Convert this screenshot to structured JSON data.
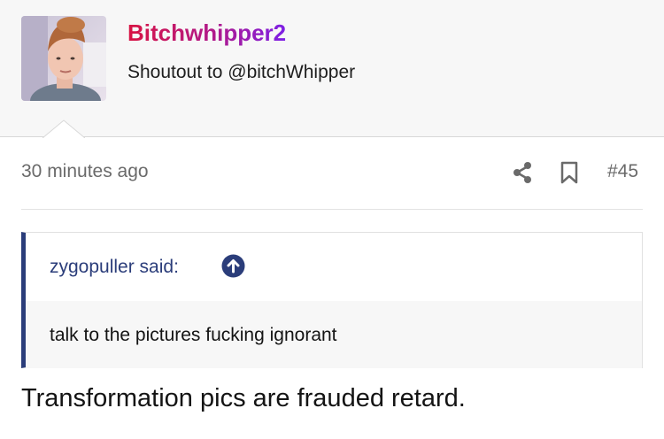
{
  "header": {
    "username": "Bitchwhipper2",
    "user_title": "Shoutout to @bitchWhipper",
    "avatar_icon": "user-avatar-photo"
  },
  "meta": {
    "timestamp": "30 minutes ago",
    "post_number": "#45",
    "share_icon": "share-icon",
    "bookmark_icon": "bookmark-icon"
  },
  "quote": {
    "author": "zygopuller said:",
    "text": "talk to the pictures fucking ignorant",
    "jump_icon": "arrow-up-circle-icon",
    "accent_color": "#2b3d7a"
  },
  "post": {
    "body": "Transformation pics are frauded retard."
  },
  "colors": {
    "username_gradient_start": "#d81443",
    "username_gradient_end": "#7d1fe6",
    "header_bg": "#f7f7f7",
    "meta_text": "#6a6a6a"
  }
}
